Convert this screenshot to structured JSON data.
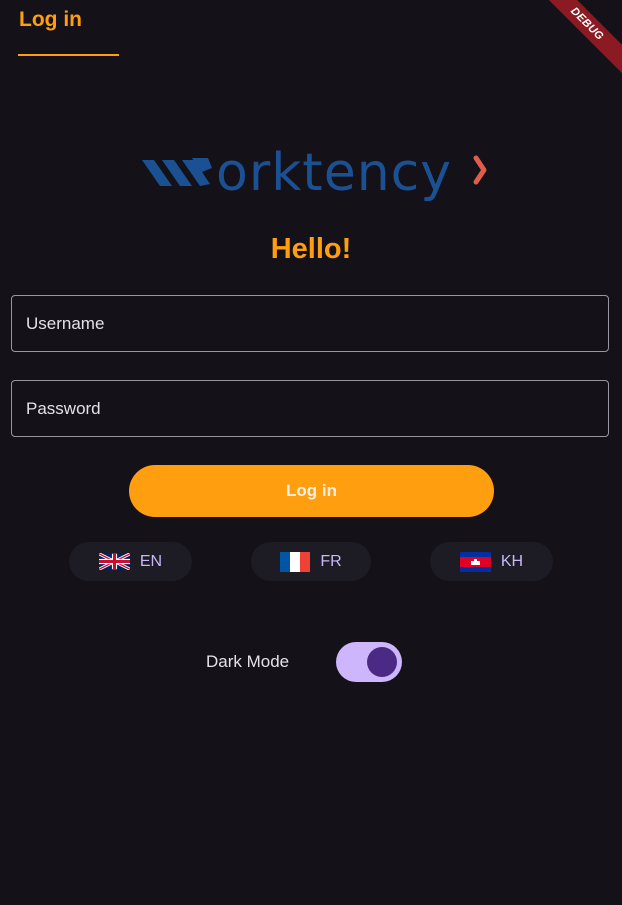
{
  "tab": {
    "label": "Log in"
  },
  "debug_banner": "DEBUG",
  "logo": {
    "text": "orktency",
    "alt": "Worktency logo",
    "color": "#1b5193",
    "accent": "#e05d4b"
  },
  "greeting": "Hello!",
  "form": {
    "username_placeholder": "Username",
    "password_placeholder": "Password",
    "login_label": "Log in"
  },
  "languages": [
    {
      "code": "EN",
      "flag": "uk-flag-icon"
    },
    {
      "code": "FR",
      "flag": "france-flag-icon"
    },
    {
      "code": "KH",
      "flag": "cambodia-flag-icon"
    }
  ],
  "dark_mode": {
    "label": "Dark Mode",
    "enabled": true
  },
  "colors": {
    "background": "#141218",
    "accent": "#ff9e0f",
    "switch_track": "#cdb6fb",
    "switch_thumb": "#4b2a86"
  }
}
